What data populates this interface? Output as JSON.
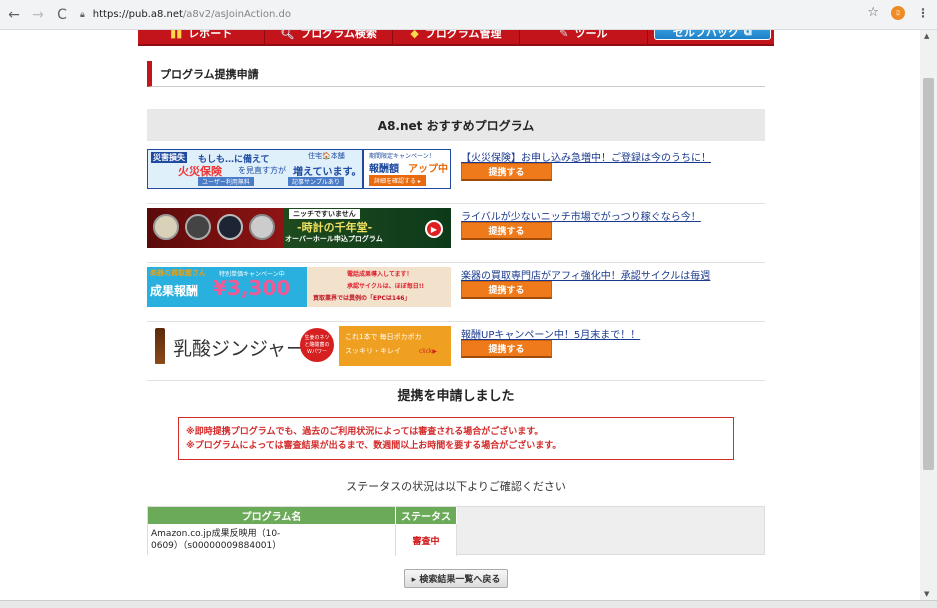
{
  "browser": {
    "back": "←",
    "forward": "→",
    "reload": "C",
    "url_host": "https://pub.a8.net",
    "url_path": "/a8v2/asJoinAction.do",
    "star": "☆",
    "profile": "ﾛ",
    "menu": "⋮"
  },
  "nav": {
    "report": "レポート",
    "program_search": "プログラム検索",
    "program_manage": "プログラム管理",
    "tools": "ツール",
    "selfback": "セルフバック"
  },
  "page": {
    "title": "プログラム提携申請",
    "rec_heading": "A8.net おすすめプログラム",
    "tie_button": "提携する"
  },
  "programs": [
    {
      "link": "【火災保険】お申し込み急増中！ご登録は今のうちに！",
      "banner": {
        "tag": "災害損失",
        "l1": "もしも…に備えて",
        "l2a": "火災保険",
        "l2b": "を見直す方が",
        "l2c": "増えています。",
        "b1": "ユーザー利用無料",
        "b2": "記事サンプルあり",
        "r1": "期間限定キャンペーン！",
        "r2a": "報酬額",
        "r2b": "アップ中",
        "r3": "詳細を確認する ▸",
        "logo": "住宅🏠本舗"
      }
    },
    {
      "link": "ライバルが少ないニッチ市場でがっつり稼ぐなら今！",
      "banner": {
        "tag": "ニッチですいません",
        "name": "-時計の千年堂-",
        "sub": "オーバーホール申込プログラム"
      }
    },
    {
      "link": "楽器の買取専門店がアフィ強化中！承認サイクルは毎週",
      "banner": {
        "top": "特別単価キャンペーン中",
        "shop": "楽器の買取屋さん",
        "big1": "成果報酬",
        "big2": "¥3,300",
        "r1": "電話成果導入してます！",
        "r2": "承認サイクルは、ほぼ毎日!!",
        "r3": "買取業界では異例の「EPCは146」"
      }
    },
    {
      "link": "報酬UPキャンペーン中！5月末まで！！",
      "banner": {
        "name": "乳酸ジンジャー",
        "badge": "生姜のネツと酪酸菌のWパワー",
        "r1": "これ1本で 毎日ポカポカ",
        "r2": "スッキリ・キレイ",
        "click": "click▶"
      }
    }
  ],
  "result": {
    "heading": "提携を申請しました",
    "notice1": "※即時提携プログラムでも、過去のご利用状況によっては審査される場合がございます。",
    "notice2": "※プログラムによっては審査結果が出るまで、数週間以上お時間を要する場合がございます。",
    "status_check": "ステータスの状況は以下よりご確認ください",
    "col_program": "プログラム名",
    "col_status": "ステータス",
    "program_name_1": "Amazon.co.jp成果反映用（10-",
    "program_name_2": "0609）（s00000009884001）",
    "status": "審査中",
    "back_button": "▸ 検索結果一覧へ戻る"
  }
}
